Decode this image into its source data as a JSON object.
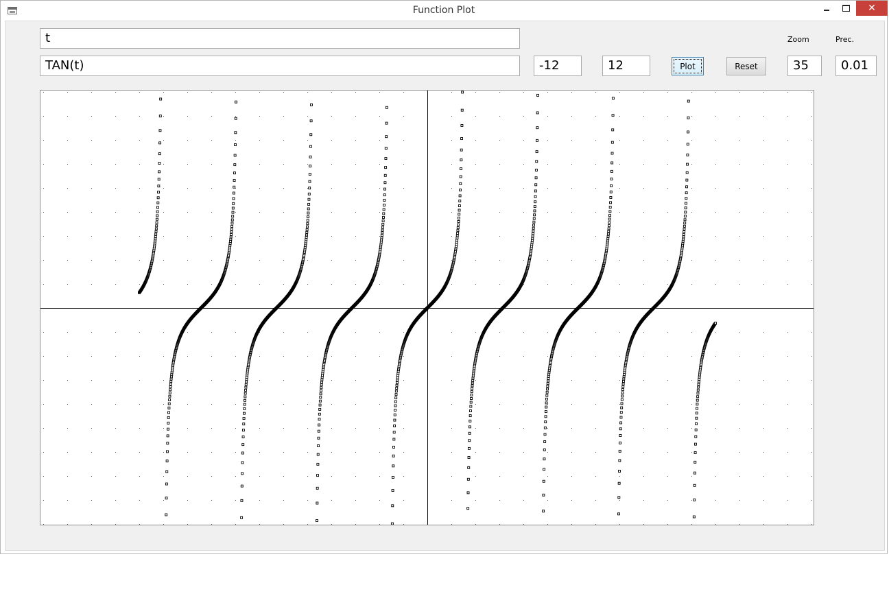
{
  "window": {
    "title": "Function Plot",
    "controls": {
      "minimize": "minimize",
      "maximize": "maximize",
      "close": "✕"
    }
  },
  "form": {
    "x_expression": "t",
    "y_expression": "TAN(t)",
    "t_min": "-12",
    "t_max": "12",
    "plot_label": "Plot",
    "reset_label": "Reset",
    "zoom_label": "Zoom",
    "zoom_value": "35",
    "precision_label": "Prec.",
    "precision_value": "0.01"
  },
  "chart_data": {
    "type": "scatter",
    "x_expression": "t",
    "y_expression": "TAN(t)",
    "t_range": [
      -12,
      12
    ],
    "step": 0.01,
    "zoom": 35,
    "grid": true,
    "grid_style": "dotted",
    "point_color": "#000000",
    "axis_color": "#000000"
  }
}
